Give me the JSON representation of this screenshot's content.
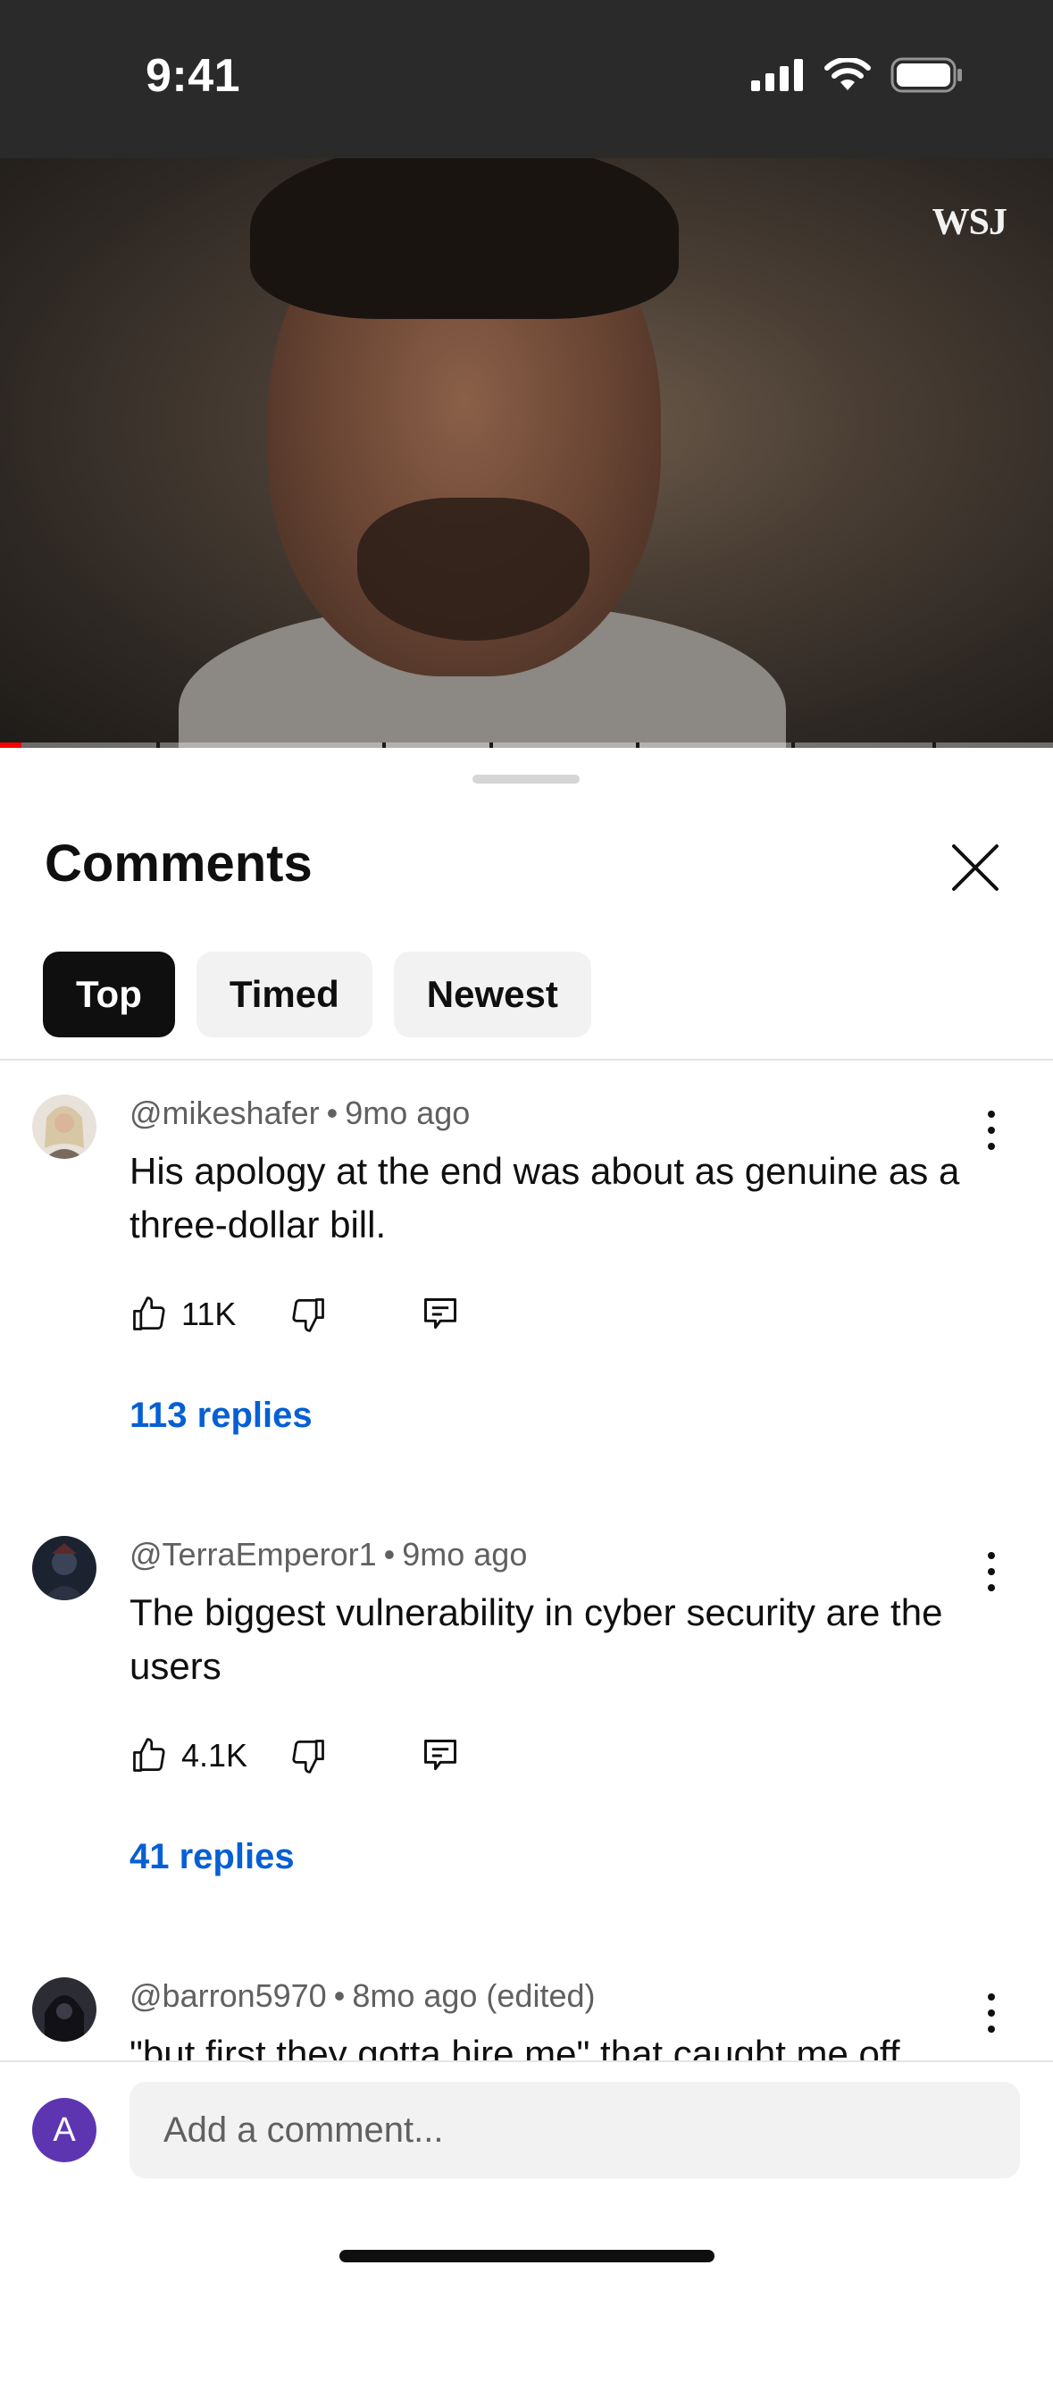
{
  "status_bar": {
    "time": "9:41",
    "icons": [
      "cellular-signal-icon",
      "wifi-icon",
      "battery-icon"
    ]
  },
  "video": {
    "watermark": "WSJ",
    "progress_fraction": 0.02
  },
  "sheet": {
    "title": "Comments",
    "close_icon": "close-icon",
    "filters": [
      {
        "label": "Top",
        "selected": true
      },
      {
        "label": "Timed",
        "selected": false
      },
      {
        "label": "Newest",
        "selected": false
      }
    ]
  },
  "comments": [
    {
      "handle": "@mikeshafer",
      "age": "9mo ago",
      "text": "His apology at the end was about as genuine as a three-dollar bill.",
      "likes": "11K",
      "replies": "113 replies"
    },
    {
      "handle": "@TerraEmperor1",
      "age": "9mo ago",
      "text": "The biggest vulnerability in cyber security are the users",
      "likes": "4.1K",
      "replies": "41 replies"
    },
    {
      "handle": "@barron5970",
      "age": "8mo ago (edited)",
      "text": "\"but first they gotta hire me\" that caught me off",
      "likes": "",
      "replies": ""
    }
  ],
  "composer": {
    "avatar_letter": "A",
    "placeholder": "Add a comment..."
  },
  "colors": {
    "link": "#065fd4",
    "chip_active_bg": "#0f0f0f",
    "chip_bg": "#f2f2f2",
    "avatar_bg": "#5e35b1",
    "progress": "#ff0000"
  }
}
